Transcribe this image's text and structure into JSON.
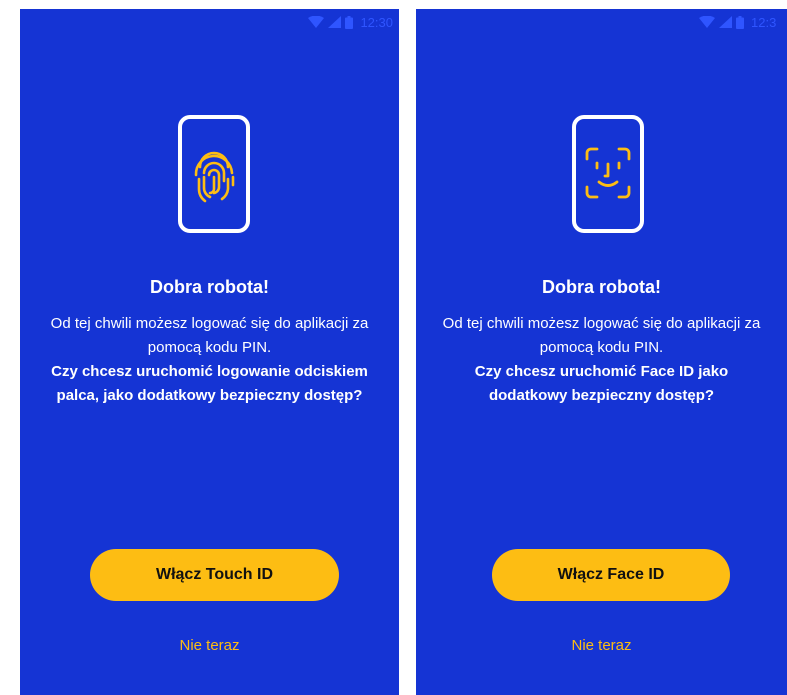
{
  "colors": {
    "background": "#1534d4",
    "accent": "#fdbd13",
    "text": "#ffffff",
    "status": "#2f55ff"
  },
  "screens": [
    {
      "status_time": "12:30",
      "icon": "fingerprint-icon",
      "title": "Dobra robota!",
      "text_regular": "Od tej chwili możesz logować się do aplikacji za pomocą kodu PIN.",
      "text_bold": "Czy chcesz uruchomić logowanie odciskiem palca, jako dodatkowy bezpieczny dostęp?",
      "primary_label": "Włącz Touch ID",
      "secondary_label": "Nie teraz"
    },
    {
      "status_time": "12:3",
      "icon": "face-id-icon",
      "title": "Dobra robota!",
      "text_regular": "Od tej chwili możesz logować się do aplikacji za pomocą kodu PIN.",
      "text_bold": "Czy chcesz uruchomić Face ID jako dodatkowy bezpieczny dostęp?",
      "primary_label": "Włącz Face ID",
      "secondary_label": "Nie teraz"
    }
  ]
}
